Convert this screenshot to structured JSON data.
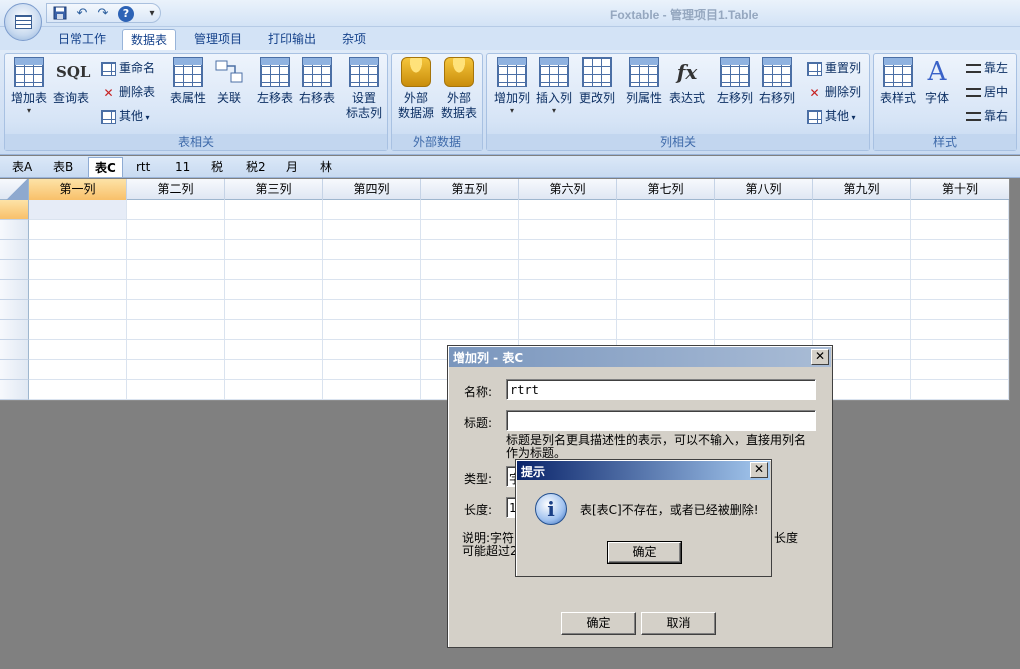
{
  "app": {
    "title": "Foxtable - 管理项目1.Table"
  },
  "qat": {
    "save_icon": "save-icon",
    "undo_icon": "undo-icon",
    "redo_icon": "redo-icon",
    "help_icon": "help-icon",
    "help_glyph": "?",
    "customize_glyph": "▾"
  },
  "tabs": [
    {
      "label": "日常工作"
    },
    {
      "label": "数据表"
    },
    {
      "label": "管理项目"
    },
    {
      "label": "打印输出"
    },
    {
      "label": "杂项"
    }
  ],
  "active_tab": "数据表",
  "ribbon": {
    "table_group": {
      "label": "表相关",
      "add_table": "增加表",
      "query_table": "查询表",
      "sql_text": "SQL",
      "rename": "重命名",
      "delete_table": "删除表",
      "other": "其他",
      "table_props": "表属性",
      "relation": "关联",
      "move_left": "左移表",
      "move_right": "右移表",
      "set_flag_1": "设置",
      "set_flag_2": "标志列"
    },
    "external_group": {
      "label": "外部数据",
      "ext_source_1": "外部",
      "ext_source_2": "数据源",
      "ext_table_1": "外部",
      "ext_table_2": "数据表"
    },
    "column_group": {
      "label": "列相关",
      "add_col": "增加列",
      "insert_col": "插入列",
      "change_col": "更改列",
      "col_props": "列属性",
      "expression": "表达式",
      "fx_text": "fx",
      "move_left": "左移列",
      "move_right": "右移列",
      "reset_col": "重置列",
      "delete_col": "删除列",
      "other": "其他"
    },
    "style_group": {
      "label": "样式",
      "table_style": "表样式",
      "font": "字体",
      "font_glyph": "A",
      "align_left": "靠左",
      "align_center": "居中",
      "align_right": "靠右"
    }
  },
  "sheet_tabs": [
    {
      "label": "表A"
    },
    {
      "label": "表B"
    },
    {
      "label": "表C"
    },
    {
      "label": "rtt"
    },
    {
      "label": "11"
    },
    {
      "label": "税"
    },
    {
      "label": "税2"
    },
    {
      "label": "月"
    },
    {
      "label": "林"
    }
  ],
  "active_sheet": "表C",
  "grid": {
    "columns": [
      "第一列",
      "第二列",
      "第三列",
      "第四列",
      "第五列",
      "第六列",
      "第七列",
      "第八列",
      "第九列",
      "第十列"
    ]
  },
  "add_column_dialog": {
    "title": "增加列 - 表C",
    "close_glyph": "✕",
    "name_label": "名称:",
    "name_value": "rtrt",
    "caption_label": "标题:",
    "caption_value": "",
    "caption_hint_1": "标题是列名更具描述性的表示，可以不输入，直接用列名",
    "caption_hint_2": "作为标题。",
    "type_label": "类型:",
    "type_value_partial": "字",
    "length_label": "长度:",
    "length_value_partial": "1",
    "note_1a": "说明:字符",
    "note_1b": "长度",
    "note_2a": "可能超过2",
    "ok": "确定",
    "cancel": "取消"
  },
  "message_box": {
    "title": "提示",
    "close_glyph": "✕",
    "icon_glyph": "i",
    "text": "表[表C]不存在，或者已经被删除!",
    "ok": "确定"
  }
}
